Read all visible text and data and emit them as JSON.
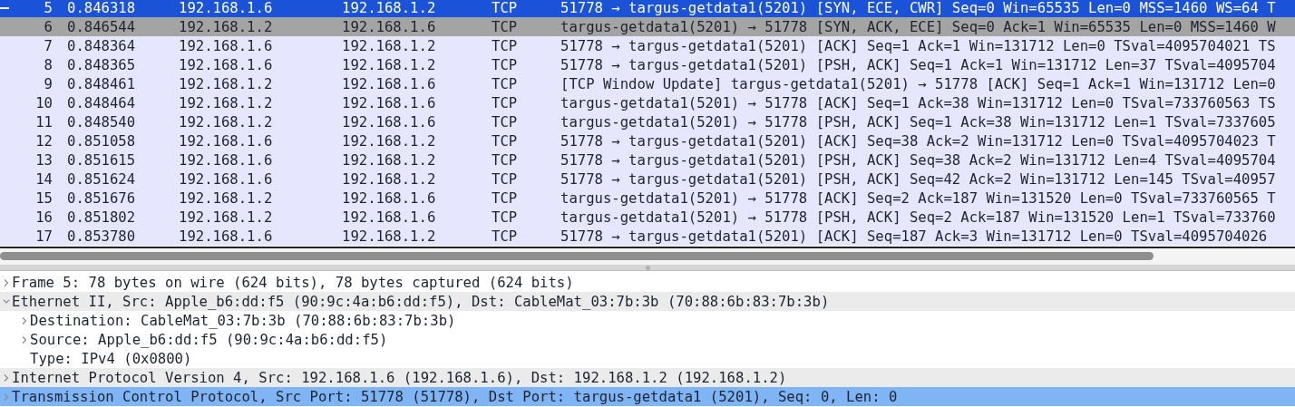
{
  "packets": [
    {
      "no": "5",
      "time": "0.846318",
      "source": "192.168.1.6",
      "destination": "192.168.1.2",
      "protocol": "TCP",
      "info": "51778 → targus-getdata1(5201) [SYN, ECE, CWR] Seq=0 Win=65535 Len=0 MSS=1460 WS=64 T",
      "selected": true,
      "related": false,
      "conversation_start": true
    },
    {
      "no": "6",
      "time": "0.846544",
      "source": "192.168.1.2",
      "destination": "192.168.1.6",
      "protocol": "TCP",
      "info": "targus-getdata1(5201) → 51778 [SYN, ACK, ECE] Seq=0 Ack=1 Win=65535 Len=0 MSS=1460 W",
      "selected": false,
      "related": true,
      "conversation_start": false
    },
    {
      "no": "7",
      "time": "0.848364",
      "source": "192.168.1.6",
      "destination": "192.168.1.2",
      "protocol": "TCP",
      "info": "51778 → targus-getdata1(5201) [ACK] Seq=1 Ack=1 Win=131712 Len=0 TSval=4095704021 TS",
      "selected": false,
      "related": false,
      "conversation_start": false
    },
    {
      "no": "8",
      "time": "0.848365",
      "source": "192.168.1.6",
      "destination": "192.168.1.2",
      "protocol": "TCP",
      "info": "51778 → targus-getdata1(5201) [PSH, ACK] Seq=1 Ack=1 Win=131712 Len=37 TSval=4095704",
      "selected": false,
      "related": false,
      "conversation_start": false
    },
    {
      "no": "9",
      "time": "0.848461",
      "source": "192.168.1.2",
      "destination": "192.168.1.6",
      "protocol": "TCP",
      "info": "[TCP Window Update] targus-getdata1(5201) → 51778 [ACK] Seq=1 Ack=1 Win=131712 Len=0",
      "selected": false,
      "related": false,
      "conversation_start": false
    },
    {
      "no": "10",
      "time": "0.848464",
      "source": "192.168.1.2",
      "destination": "192.168.1.6",
      "protocol": "TCP",
      "info": "targus-getdata1(5201) → 51778 [ACK] Seq=1 Ack=38 Win=131712 Len=0 TSval=733760563 TS",
      "selected": false,
      "related": false,
      "conversation_start": false
    },
    {
      "no": "11",
      "time": "0.848540",
      "source": "192.168.1.2",
      "destination": "192.168.1.6",
      "protocol": "TCP",
      "info": "targus-getdata1(5201) → 51778 [PSH, ACK] Seq=1 Ack=38 Win=131712 Len=1 TSval=7337605",
      "selected": false,
      "related": false,
      "conversation_start": false
    },
    {
      "no": "12",
      "time": "0.851058",
      "source": "192.168.1.6",
      "destination": "192.168.1.2",
      "protocol": "TCP",
      "info": "51778 → targus-getdata1(5201) [ACK] Seq=38 Ack=2 Win=131712 Len=0 TSval=4095704023 T",
      "selected": false,
      "related": false,
      "conversation_start": false
    },
    {
      "no": "13",
      "time": "0.851615",
      "source": "192.168.1.6",
      "destination": "192.168.1.2",
      "protocol": "TCP",
      "info": "51778 → targus-getdata1(5201) [PSH, ACK] Seq=38 Ack=2 Win=131712 Len=4 TSval=4095704",
      "selected": false,
      "related": false,
      "conversation_start": false
    },
    {
      "no": "14",
      "time": "0.851624",
      "source": "192.168.1.6",
      "destination": "192.168.1.2",
      "protocol": "TCP",
      "info": "51778 → targus-getdata1(5201) [PSH, ACK] Seq=42 Ack=2 Win=131712 Len=145 TSval=40957",
      "selected": false,
      "related": false,
      "conversation_start": false
    },
    {
      "no": "15",
      "time": "0.851676",
      "source": "192.168.1.2",
      "destination": "192.168.1.6",
      "protocol": "TCP",
      "info": "targus-getdata1(5201) → 51778 [ACK] Seq=2 Ack=187 Win=131520 Len=0 TSval=733760565 T",
      "selected": false,
      "related": false,
      "conversation_start": false
    },
    {
      "no": "16",
      "time": "0.851802",
      "source": "192.168.1.2",
      "destination": "192.168.1.6",
      "protocol": "TCP",
      "info": "targus-getdata1(5201) → 51778 [PSH, ACK] Seq=2 Ack=187 Win=131520 Len=1 TSval=733760",
      "selected": false,
      "related": false,
      "conversation_start": false
    },
    {
      "no": "17",
      "time": "0.853780",
      "source": "192.168.1.6",
      "destination": "192.168.1.2",
      "protocol": "TCP",
      "info": "51778 → targus-getdata1(5201) [ACK] Seq=187 Ack=3 Win=131712 Len=0 TSval=4095704026",
      "selected": false,
      "related": false,
      "conversation_start": false
    }
  ],
  "details": [
    {
      "text": "Frame 5: 78 bytes on wire (624 bits), 78 bytes captured (624 bits)",
      "expandable": true,
      "expanded": false,
      "selected": false,
      "shaded": false
    },
    {
      "text": "Ethernet II, Src: Apple_b6:dd:f5 (90:9c:4a:b6:dd:f5), Dst: CableMat_03:7b:3b (70:88:6b:83:7b:3b)",
      "expandable": true,
      "expanded": true,
      "selected": false,
      "shaded": true,
      "children": [
        {
          "text": "Destination: CableMat_03:7b:3b (70:88:6b:83:7b:3b)",
          "expandable": true,
          "expanded": false,
          "selected": false,
          "shaded": false
        },
        {
          "text": "Source: Apple_b6:dd:f5 (90:9c:4a:b6:dd:f5)",
          "expandable": true,
          "expanded": false,
          "selected": false,
          "shaded": false
        },
        {
          "text": "Type: IPv4 (0x0800)",
          "expandable": false,
          "expanded": false,
          "selected": false,
          "shaded": false
        }
      ]
    },
    {
      "text": "Internet Protocol Version 4, Src: 192.168.1.6 (192.168.1.6), Dst: 192.168.1.2 (192.168.1.2)",
      "expandable": true,
      "expanded": false,
      "selected": false,
      "shaded": true
    },
    {
      "text": "Transmission Control Protocol, Src Port: 51778 (51778), Dst Port: targus-getdata1 (5201), Seq: 0, Len: 0",
      "expandable": true,
      "expanded": false,
      "selected": true,
      "shaded": false
    }
  ]
}
